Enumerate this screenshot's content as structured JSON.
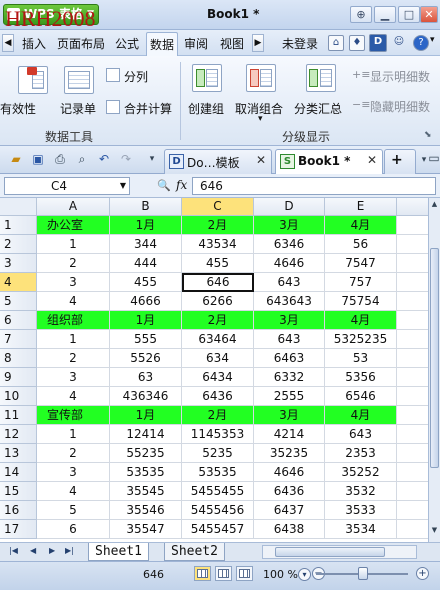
{
  "watermark": "HRH2008",
  "app": {
    "name": "WPS 表格",
    "title": "Book1 *"
  },
  "menu": {
    "items": [
      "插入",
      "页面布局",
      "公式",
      "数据",
      "审阅",
      "视图"
    ],
    "active": "数据",
    "account": "未登录"
  },
  "ribbon": {
    "tools": {
      "validity": "有效性",
      "record": "记录单",
      "split": "分列",
      "consolidate": "合并计算",
      "group_title": "数据工具"
    },
    "outline": {
      "create_group": "创建组",
      "ungroup": "取消组合",
      "subtotal": "分类汇总",
      "show_detail": "显示明细数",
      "hide_detail": "隐藏明细数",
      "group_title": "分级显示"
    }
  },
  "tabs": [
    {
      "label": "Do…模板",
      "active": false
    },
    {
      "label": "Book1 *",
      "active": true
    }
  ],
  "formula_bar": {
    "cell_ref": "C4",
    "fx": "fx",
    "value": "646"
  },
  "grid": {
    "columns": [
      "A",
      "B",
      "C",
      "D",
      "E"
    ],
    "selected_column": "C",
    "selected_row": "4",
    "active_cell": "C4",
    "highlight_color": "#22ff22",
    "rows": [
      {
        "n": "1",
        "header": true,
        "cells": [
          "办公室",
          "1月",
          "2月",
          "3月",
          "4月"
        ]
      },
      {
        "n": "2",
        "cells": [
          "1",
          "344",
          "43534",
          "6346",
          "56"
        ]
      },
      {
        "n": "3",
        "cells": [
          "2",
          "444",
          "455",
          "4646",
          "7547"
        ]
      },
      {
        "n": "4",
        "cells": [
          "3",
          "455",
          "646",
          "643",
          "757"
        ]
      },
      {
        "n": "5",
        "cells": [
          "4",
          "4666",
          "6266",
          "643643",
          "75754"
        ]
      },
      {
        "n": "6",
        "header": true,
        "cells": [
          "组织部",
          "1月",
          "2月",
          "3月",
          "4月"
        ]
      },
      {
        "n": "7",
        "cells": [
          "1",
          "555",
          "63464",
          "643",
          "5325235"
        ]
      },
      {
        "n": "8",
        "cells": [
          "2",
          "5526",
          "634",
          "6463",
          "53"
        ]
      },
      {
        "n": "9",
        "cells": [
          "3",
          "63",
          "6434",
          "6332",
          "5356"
        ]
      },
      {
        "n": "10",
        "cells": [
          "4",
          "436346",
          "6436",
          "2555",
          "6546"
        ]
      },
      {
        "n": "11",
        "header": true,
        "cells": [
          "宣传部",
          "1月",
          "2月",
          "3月",
          "4月"
        ]
      },
      {
        "n": "12",
        "cells": [
          "1",
          "12414",
          "1145353",
          "4214",
          "643"
        ]
      },
      {
        "n": "13",
        "cells": [
          "2",
          "55235",
          "5235",
          "35235",
          "2353"
        ]
      },
      {
        "n": "14",
        "cells": [
          "3",
          "53535",
          "53535",
          "4646",
          "35252"
        ]
      },
      {
        "n": "15",
        "cells": [
          "4",
          "35545",
          "5455455",
          "6436",
          "3532"
        ]
      },
      {
        "n": "16",
        "cells": [
          "5",
          "35546",
          "5455456",
          "6437",
          "3533"
        ]
      },
      {
        "n": "17",
        "cells": [
          "6",
          "35547",
          "5455457",
          "6438",
          "3534"
        ]
      }
    ]
  },
  "sheets": [
    "Sheet1",
    "Sheet2"
  ],
  "active_sheet": "Sheet1",
  "status": {
    "value": "646",
    "zoom": "100 %"
  }
}
